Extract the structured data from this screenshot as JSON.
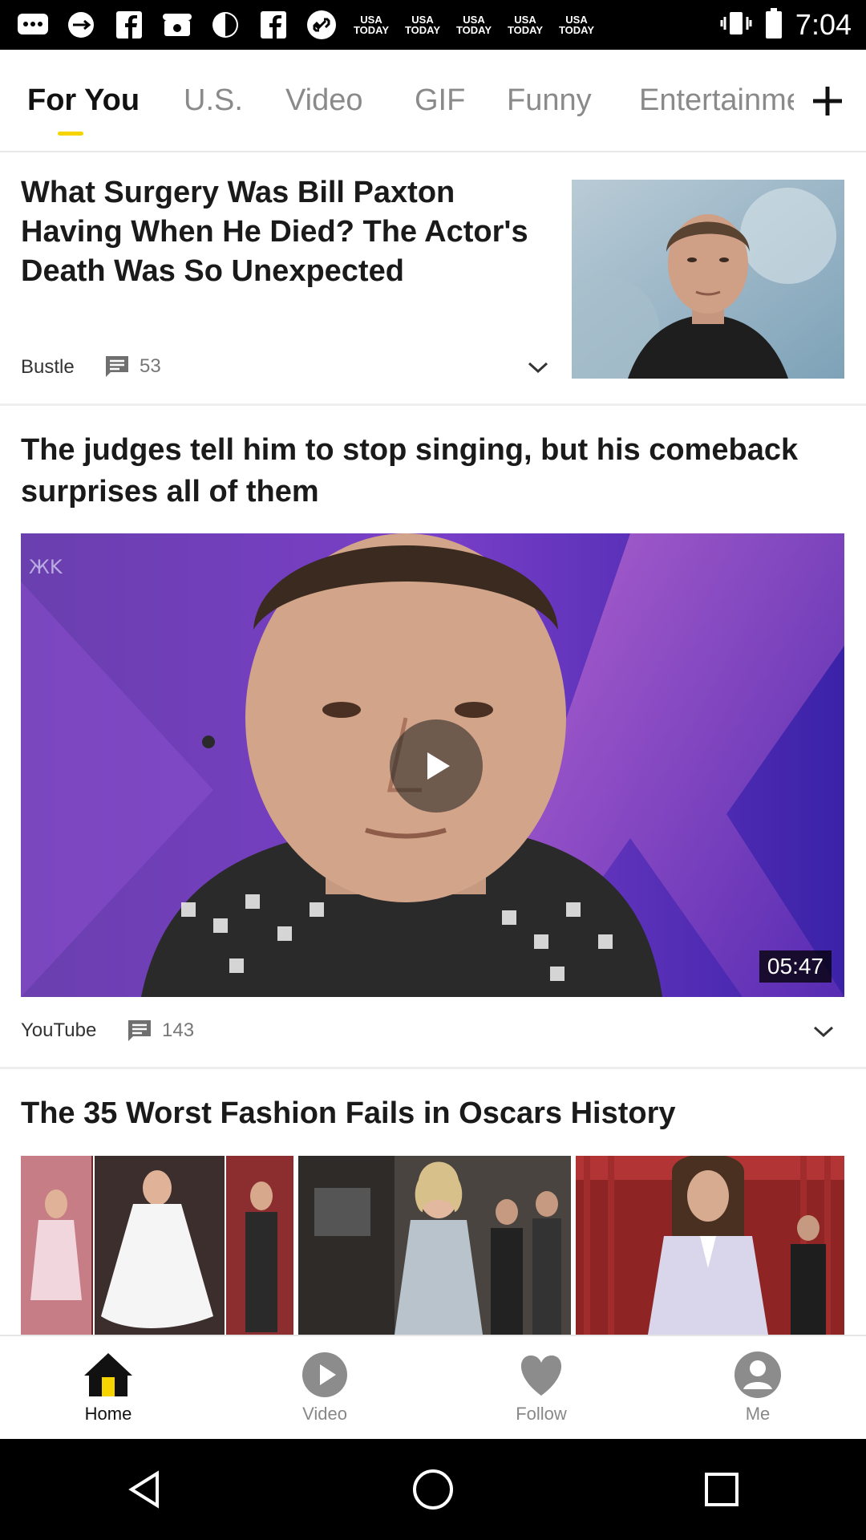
{
  "status_bar": {
    "icons": [
      "messages-icon",
      "usb-icon",
      "facebook-icon",
      "phone-icon",
      "do-not-disturb-icon",
      "facebook-icon",
      "link-icon"
    ],
    "usa_today_badges": [
      "USA TODAY",
      "USA TODAY",
      "USA TODAY",
      "USA TODAY",
      "USA TODAY"
    ],
    "time": "7:04"
  },
  "tabs": {
    "items": [
      "For You",
      "U.S.",
      "Video",
      "GIF",
      "Funny",
      "Entertainment"
    ],
    "active_index": 0,
    "indicator_color": "#f7d400"
  },
  "articles": [
    {
      "headline": "What Surgery Was Bill Paxton Having When He Died? The Actor's Death Was So Unexpected",
      "source": "Bustle",
      "comments": "53",
      "media": "thumbnail"
    },
    {
      "headline": "The judges tell him to stop singing, but his comeback surprises all of them",
      "source": "YouTube",
      "comments": "143",
      "media": "video",
      "duration": "05:47"
    },
    {
      "headline": "The 35 Worst Fashion Fails in Oscars History",
      "media": "gallery"
    }
  ],
  "bottom_nav": {
    "items": [
      {
        "label": "Home",
        "icon": "home-icon"
      },
      {
        "label": "Video",
        "icon": "play-circle-icon"
      },
      {
        "label": "Follow",
        "icon": "heart-icon"
      },
      {
        "label": "Me",
        "icon": "person-icon"
      }
    ],
    "active_index": 0,
    "accent": "#f7d400"
  },
  "system_nav": [
    "back-icon",
    "home-icon",
    "recents-icon"
  ]
}
